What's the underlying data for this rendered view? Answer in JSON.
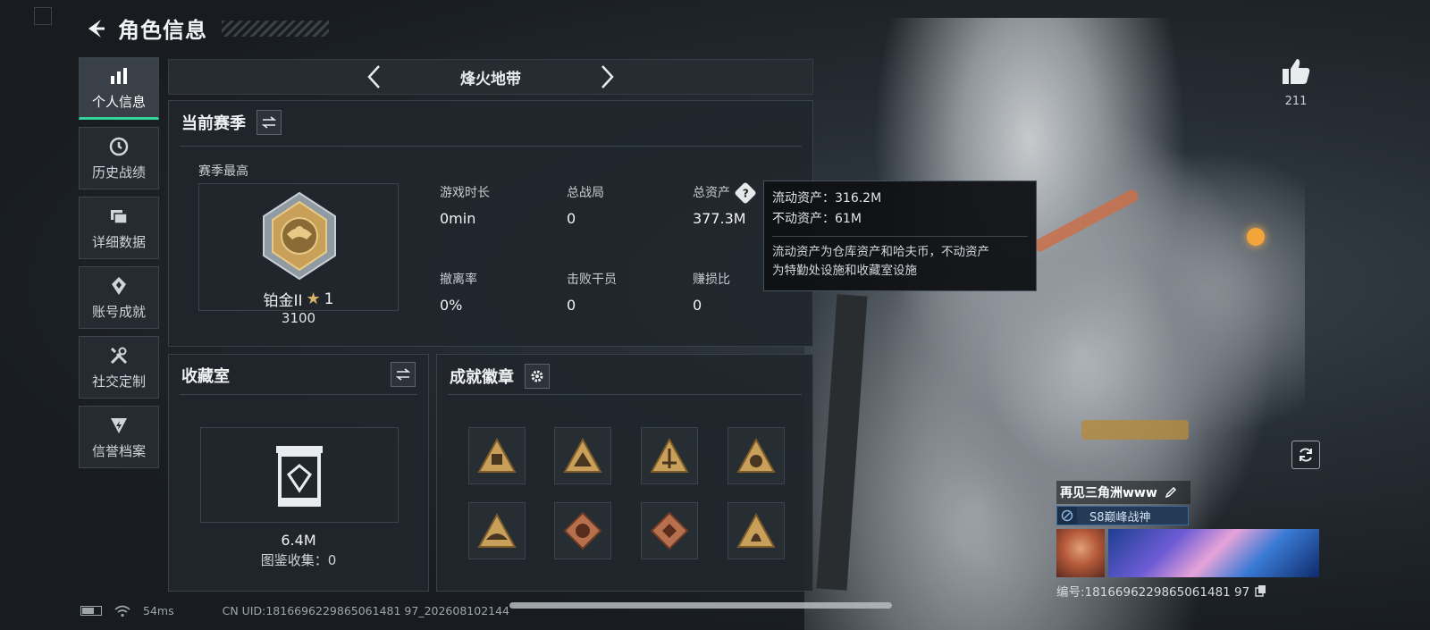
{
  "header": {
    "title": "角色信息"
  },
  "sidebar": {
    "items": [
      {
        "label": "个人信息",
        "icon": "bar-chart-icon",
        "active": true
      },
      {
        "label": "历史战绩",
        "icon": "history-icon",
        "active": false
      },
      {
        "label": "详细数据",
        "icon": "folder-icon",
        "active": false
      },
      {
        "label": "账号成就",
        "icon": "achievement-icon",
        "active": false
      },
      {
        "label": "社交定制",
        "icon": "tools-icon",
        "active": false
      },
      {
        "label": "信誉档案",
        "icon": "credit-icon",
        "active": false
      }
    ]
  },
  "mode": {
    "title": "烽火地带"
  },
  "season": {
    "title": "当前赛季",
    "best_label": "赛季最高",
    "rank_name": "铂金II",
    "rank_stars": "1",
    "rank_score": "3100",
    "stats": [
      {
        "label": "游戏时长",
        "value": "0min"
      },
      {
        "label": "总战局",
        "value": "0"
      },
      {
        "label": "总资产",
        "value": "377.3M"
      },
      {
        "label": "撤离率",
        "value": "0%"
      },
      {
        "label": "击败干员",
        "value": "0"
      },
      {
        "label": "赚损比",
        "value": "0"
      }
    ]
  },
  "tooltip": {
    "liquid": "流动资产：316.2M",
    "fixed": "不动资产：61M",
    "desc1": "流动资产为仓库资产和哈夫币，不动资产",
    "desc2": "为特勤处设施和收藏室设施"
  },
  "collection": {
    "title": "收藏室",
    "value": "6.4M",
    "count": "图鉴收集：0"
  },
  "badges": {
    "title": "成就徽章",
    "items": [
      "badge-1",
      "badge-2",
      "badge-3",
      "badge-4",
      "badge-5",
      "badge-6",
      "badge-7",
      "badge-8"
    ]
  },
  "likes": {
    "count": "211"
  },
  "player": {
    "name": "再见三角洲www",
    "title": "S8巅峰战神",
    "id": "编号:1816696229865061481 97"
  },
  "status": {
    "ping": "54ms",
    "uid": "CN UID:1816696229865061481 97_202608102144"
  },
  "colors": {
    "accent": "#34d399",
    "gold": "#c9a05a",
    "tooltip_bg": "#0f1114"
  }
}
